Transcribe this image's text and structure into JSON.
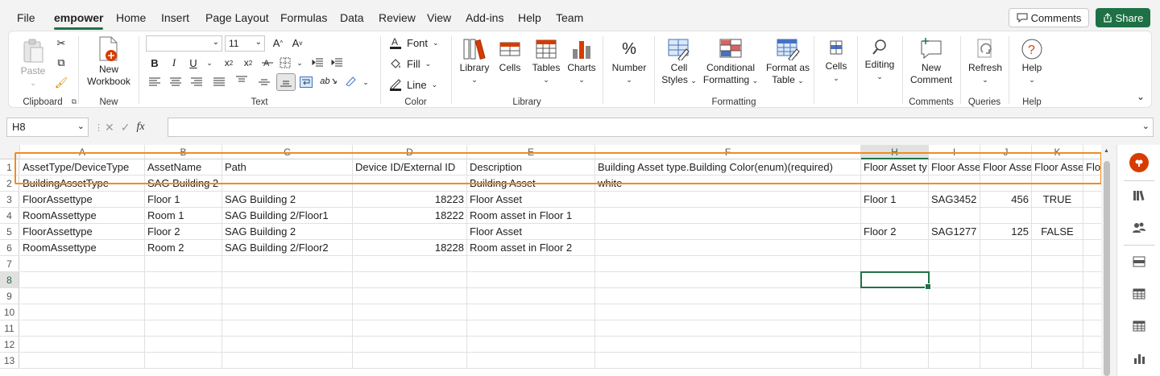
{
  "menu": {
    "items": [
      "File",
      "empower",
      "Home",
      "Insert",
      "Page Layout",
      "Formulas",
      "Data",
      "Review",
      "View",
      "Add-ins",
      "Help",
      "Team"
    ],
    "active": "empower",
    "comments_label": "Comments",
    "share_label": "Share"
  },
  "ribbon": {
    "clipboard": {
      "paste": "Paste",
      "group": "Clipboard"
    },
    "new": {
      "new_workbook_line1": "New",
      "new_workbook_line2": "Workbook",
      "group": "New"
    },
    "text": {
      "font_size": "11",
      "group": "Text"
    },
    "color": {
      "font": "Font",
      "fill": "Fill",
      "line": "Line",
      "group": "Color"
    },
    "library": {
      "library": "Library",
      "cells": "Cells",
      "tables": "Tables",
      "charts": "Charts",
      "group": "Library"
    },
    "number": {
      "number": "Number"
    },
    "formatting": {
      "cell_styles_1": "Cell",
      "cell_styles_2": "Styles",
      "cond_1": "Conditional",
      "cond_2": "Formatting",
      "fmt_table_1": "Format as",
      "fmt_table_2": "Table",
      "group": "Formatting"
    },
    "cells": {
      "cells": "Cells"
    },
    "editing": {
      "editing": "Editing"
    },
    "comments": {
      "new_comment_1": "New",
      "new_comment_2": "Comment",
      "group": "Comments"
    },
    "queries": {
      "refresh": "Refresh",
      "group": "Queries"
    },
    "help": {
      "help": "Help",
      "group": "Help"
    }
  },
  "formula_bar": {
    "name_box": "H8",
    "fx": "fx",
    "formula": ""
  },
  "sheet": {
    "columns": [
      "A",
      "B",
      "C",
      "D",
      "E",
      "F",
      "H",
      "I",
      "J",
      "K"
    ],
    "selected_column": "H",
    "selected_row": "8",
    "rows": [
      "1",
      "2",
      "3",
      "4",
      "5",
      "6",
      "7",
      "8",
      "9",
      "10",
      "11",
      "12",
      "13"
    ],
    "cells": {
      "r1": [
        "AssetType/DeviceType",
        "AssetName",
        "Path",
        "Device ID/External ID",
        "Description",
        "Building Asset type.Building Color(enum)(required)",
        "Floor Asset ty",
        "Floor Asse",
        "Floor Asse",
        "Floor Asse",
        "Flo"
      ],
      "r2": [
        "BuildingAssetType",
        "SAG Building 2",
        "",
        "",
        "Building Asset",
        "white",
        "",
        "",
        "",
        "",
        ""
      ],
      "r3": [
        "FloorAssettype",
        "Floor 1",
        "SAG Building 2",
        "18223",
        "Floor Asset",
        "",
        "Floor 1",
        "SAG3452",
        "456",
        "TRUE",
        ""
      ],
      "r4": [
        "RoomAssettype",
        "Room 1",
        "SAG Building 2/Floor1",
        "18222",
        "Room asset in Floor 1",
        "",
        "",
        "",
        "",
        "",
        ""
      ],
      "r5": [
        "FloorAssettype",
        "Floor 2",
        "SAG Building 2",
        "",
        "Floor Asset",
        "",
        "Floor 2",
        "SAG1277",
        "125",
        "FALSE",
        ""
      ],
      "r6": [
        "RoomAssettype",
        "Room 2",
        "SAG Building 2/Floor2",
        "18228",
        "Room asset in Floor 2",
        "",
        "",
        "",
        "",
        "",
        ""
      ]
    }
  },
  "colors": {
    "accent": "#217346",
    "highlight": "#f08c1e",
    "share": "#1e7145",
    "addin": "#d83b01"
  }
}
